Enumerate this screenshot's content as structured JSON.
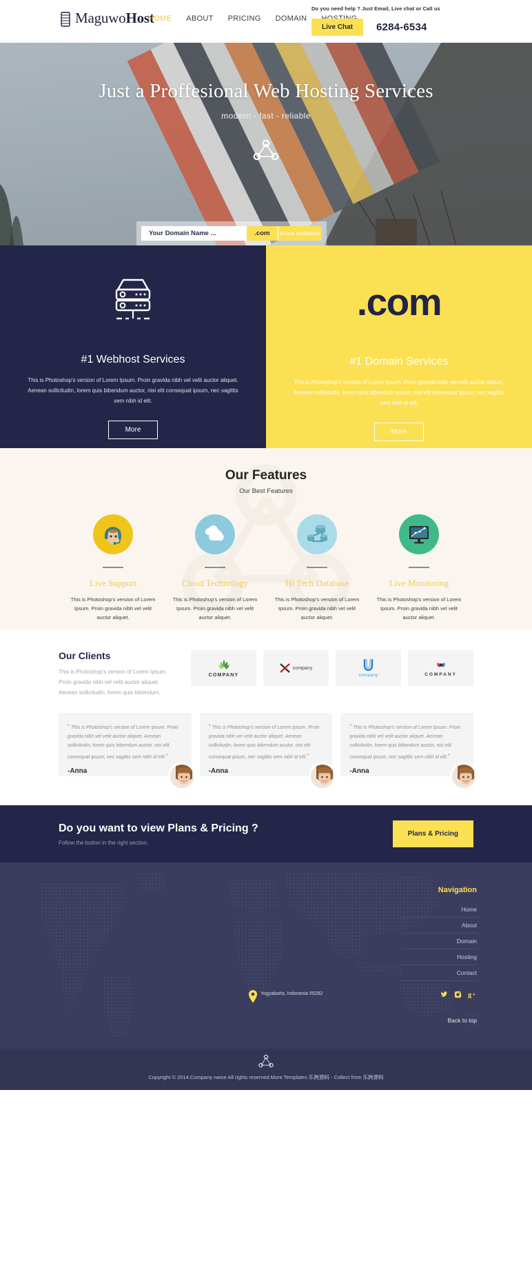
{
  "header": {
    "logo": {
      "text_bold": "Maguwo",
      "text_rest": "Host",
      "icon": "server-logo-icon"
    },
    "nav": [
      {
        "label": "HOME",
        "active": true
      },
      {
        "label": "ABOUT",
        "active": false
      },
      {
        "label": "PRICING",
        "active": false
      },
      {
        "label": "DOMAIN",
        "active": false
      },
      {
        "label": "HOSTING",
        "active": false
      }
    ],
    "help_text": "Do you need help ? Just Email, Live chat or Call us",
    "live_chat_label": "Live Chat",
    "phone": "6284-6534"
  },
  "hero": {
    "title": "Just a Proffesional Web Hosting Services",
    "subtitle": "modern - fast - reliable",
    "icon": "network-node-icon",
    "search": {
      "placeholder": "Your Domain Name ...",
      "value": "",
      "tld": ".com",
      "button_label": "Check Availability"
    }
  },
  "panels": [
    {
      "icon": "server-rack-icon",
      "title": "#1 Webhost Services",
      "desc": "This is Photoshop's version of Lorem Ipsum. Proin gravida nibh vel velit auctor aliquet. Aenean sollicitudin, lorem quis bibendum auctor, nisi elit consequat ipsum, nec sagittis sem nibh id elit.",
      "button_label": "More"
    },
    {
      "icon": "dot-com-text",
      "big_text": ".com",
      "title": "#1 Domain Services",
      "desc": "This is Photoshop's version of Lorem Ipsum. Proin gravida nibh vel velit auctor aliquet. Aenean sollicitudin, lorem quis bibendum auctor, nisi elit consequat ipsum, nec sagittis sem nibh id elit.",
      "button_label": "More"
    }
  ],
  "features": {
    "title": "Our Features",
    "subtitle": "Our Best Features",
    "items": [
      {
        "icon": "headset-support-icon",
        "icon_bg": "#f0c419",
        "name": "Live Support",
        "desc": "This is Photoshop's version of Lorem Ipsum. Proin gravida nibh vel velit auctor aliquet."
      },
      {
        "icon": "cloud-icon",
        "icon_bg": "#8ecadd",
        "name": "Cloud Technology",
        "desc": "This is Photoshop's version of Lorem Ipsum. Proin gravida nibh vel velit auctor aliquet."
      },
      {
        "icon": "database-network-icon",
        "icon_bg": "#aadbe8",
        "name": "Hi Tech Database",
        "desc": "This is Photoshop's version of Lorem Ipsum. Proin gravida nibh vel velit auctor aliquet."
      },
      {
        "icon": "monitor-chart-icon",
        "icon_bg": "#3fb98a",
        "name": "Live Monitoring",
        "desc": "This is Photoshop's version of Lorem Ipsum. Proin gravida nibh vel velit auctor aliquet."
      }
    ]
  },
  "clients": {
    "title": "Our Clients",
    "desc": "This is Photoshop's version of Lorem Ipsum. Proin gravida nibh vel velit auctor aliquet. Aenean sollicitudin, lorem quis bibendum.",
    "logos": [
      {
        "icon": "leaf-company-logo",
        "caption": "COMPANY"
      },
      {
        "icon": "x-company-logo",
        "caption": "company"
      },
      {
        "icon": "u-company-logo",
        "caption": "company"
      },
      {
        "icon": "swirl-company-logo",
        "caption": "COMPANY"
      }
    ],
    "testimonials": [
      {
        "quote": "This is Photoshop's version of Lorem Ipsum. Proin gravida nibh vel velit auctor aliquet. Aenean sollicitudin, lorem quis bibendum auctor, nisi elit consequat ipsum, nec sagittis sem nibh id elit.",
        "author": "-Anna"
      },
      {
        "quote": "This is Photoshop's version of Lorem Ipsum. Proin gravida nibh vel velit auctor aliquet. Aenean sollicitudin, lorem quis bibendum auctor, nisi elit consequat ipsum, nec sagittis sem nibh id elit.",
        "author": "-Anna"
      },
      {
        "quote": "This is Photoshop's version of Lorem Ipsum. Proin gravida nibh vel velit auctor aliquet. Aenean sollicitudin, lorem quis bibendum auctor, nisi elit consequat ipsum, nec sagittis sem nibh id elit.",
        "author": "-Anna"
      }
    ]
  },
  "cta": {
    "title": "Do you want to view Plans & Pricing ?",
    "subtitle": "Follow the button in the right section.",
    "button_label": "Plans & Pricing"
  },
  "footer": {
    "nav_title": "Navigation",
    "nav_items": [
      {
        "label": "Home"
      },
      {
        "label": "About"
      },
      {
        "label": "Domain"
      },
      {
        "label": "Hosting"
      },
      {
        "label": "Contact"
      }
    ],
    "social": [
      {
        "icon": "twitter-icon",
        "glyph": "✦"
      },
      {
        "icon": "instagram-icon",
        "glyph": "■"
      },
      {
        "icon": "google-plus-icon",
        "glyph": "g"
      }
    ],
    "back_to_top": "Back to top",
    "map_pin_label": "Yogyakarta, Indonesia 55282",
    "bottom_icon": "network-node-icon",
    "copyright": "Copyright © 2014.Company name All rights reserved.More Templates 乐跨源码 - Collect from 乐跨源码"
  },
  "colors": {
    "yellow": "#fbe053",
    "navy": "#232648",
    "footer": "#3b3d5e",
    "cream": "#faf6ef"
  }
}
